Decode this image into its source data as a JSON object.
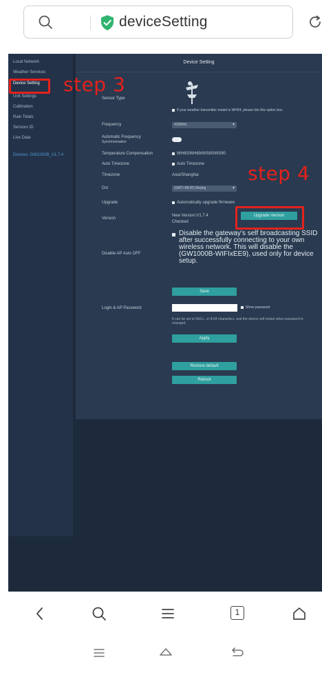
{
  "browser": {
    "url": "deviceSetting",
    "colors": {
      "secure": "#2fb56e"
    }
  },
  "sidebar": {
    "items": [
      {
        "label": "Local Network"
      },
      {
        "label": "Weather Services"
      },
      {
        "label": "Device Setting"
      },
      {
        "label": "Unit Settings"
      },
      {
        "label": "Calibration"
      },
      {
        "label": "Rain Totals"
      },
      {
        "label": "Sensors ID"
      },
      {
        "label": "Live Data"
      }
    ],
    "version": "Devices: GW1000B_V1.7.4"
  },
  "panel": {
    "title": "Device Setting",
    "sensor_type_label": "Sensor Type",
    "sensor_type_value": "If your weather transmitter model is WH24, please tick this option box.",
    "frequency_label": "Frequency",
    "frequency_value": "433MHz",
    "auto_freq_label": "Automatic Frequency",
    "auto_freq_sub": "Synchronization",
    "temp_comp_label": "Temperature Compensation",
    "temp_comp_value": "WH65/WH69/WS80/WS90",
    "auto_tz_label": "Auto Timezone",
    "auto_tz_value": "Auto Timezone",
    "timezone_label": "Timezone",
    "timezone_value": "Asia/Shanghai",
    "dst_label": "Dst",
    "dst_value": "(GMT+08:00) Beijing",
    "upgrade_label": "Upgrade",
    "upgrade_value": "Automatically upgrade firmware",
    "version_label": "Version",
    "version_value": "New Version:V1.7.4",
    "version_note": "Checked",
    "upgrade_button": "Upgrade Version",
    "disable_ap_label": "Disable AP Auto OFF",
    "disable_ap_text": "Disable the gateway's self broadcasting SSID after successfully connecting to your own wireless network. This will disable the (GW1000B-WIFIxEE9), used only for device setup.",
    "save_button": "Save",
    "login_label": "Login & AP Password",
    "show_password": "Show password",
    "password_note": "It can be set to NULL, or 8-64 characters, and the device will restart when password is changed.",
    "apply_button": "Apply",
    "restore_button": "Restore default",
    "reboot_button": "Reboot"
  },
  "annotations": {
    "step3": "step 3",
    "step4": "step 4",
    "color": "#e3221c"
  },
  "bottom_nav": {
    "tab_count": "1",
    "icons": [
      "back-icon",
      "search-icon",
      "menu-icon",
      "tabs-icon",
      "home-icon"
    ],
    "system_icons": [
      "recent-apps-icon",
      "system-home-icon",
      "system-back-icon"
    ]
  }
}
